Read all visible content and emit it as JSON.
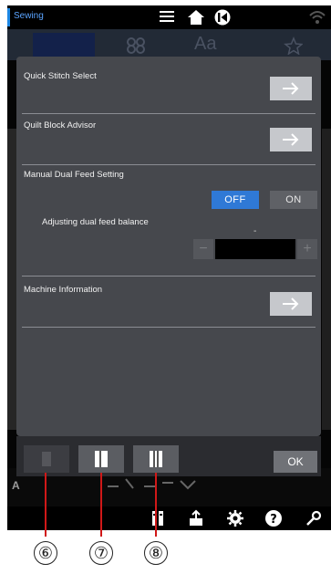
{
  "statusbar": {
    "title": "Sewing",
    "icons": [
      "menu-icon",
      "home-icon",
      "back-circle-icon",
      "wifi-icon"
    ]
  },
  "background": {
    "tabs": [
      "stitch-tab",
      "pattern-tab",
      "Aa",
      "favorites-tab"
    ],
    "strip_label": "A"
  },
  "panel": {
    "items": [
      {
        "label": "Quick Stitch Select",
        "action_icon": "arrow-right-icon"
      },
      {
        "label": "Quilt Block Advisor",
        "action_icon": "arrow-right-icon"
      },
      {
        "label": "Manual Dual Feed Setting",
        "toggle": {
          "off_label": "OFF",
          "on_label": "ON",
          "selected": "OFF"
        }
      },
      {
        "label": "Adjusting dual feed balance",
        "value": "-",
        "minus": "−",
        "plus": "+"
      },
      {
        "label": "Machine Information",
        "action_icon": "arrow-right-icon"
      }
    ]
  },
  "footer": {
    "buttons": [
      "page-button-1",
      "page-button-2",
      "page-button-3"
    ],
    "ok_label": "OK"
  },
  "bottombar": {
    "icons": [
      "book-icon",
      "export-icon",
      "settings-icon",
      "help-icon",
      "wrench-icon"
    ]
  },
  "callouts": [
    "⑥",
    "⑦",
    "⑧"
  ],
  "colors": {
    "panel": "#46484d",
    "toggle_selected": "#2f79d6",
    "callout_line": "#d01818",
    "accent": "#1e88e5"
  }
}
